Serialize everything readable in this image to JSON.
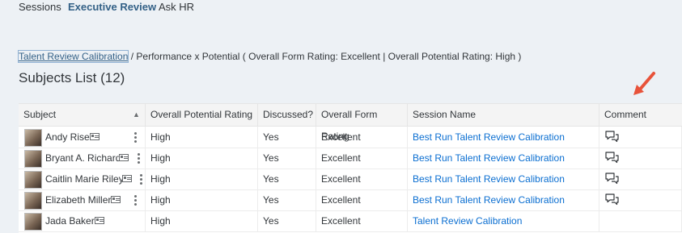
{
  "nav": {
    "tabs": [
      {
        "label": "Sessions"
      },
      {
        "label": "Executive Review",
        "active": true
      },
      {
        "label": "Ask HR"
      }
    ]
  },
  "breadcrumb": {
    "link": "Talent Review Calibration",
    "rest": " / Performance x Potential ( Overall Form Rating: Excellent | Overall Potential Rating: High )"
  },
  "list": {
    "title": "Subjects List (12)"
  },
  "table": {
    "columns": [
      "Subject",
      "Overall Potential Rating",
      "Discussed?",
      "Overall Form Rating",
      "Session Name",
      "Comment"
    ],
    "rows": [
      {
        "name": "Andy Rise",
        "potential": "High",
        "discussed": "Yes",
        "form": "Excellent",
        "session": "Best Run Talent Review Calibration",
        "comment_icon": "comment-icon"
      },
      {
        "name": "Bryant A. Richard",
        "potential": "High",
        "discussed": "Yes",
        "form": "Excellent",
        "session": "Best Run Talent Review Calibration",
        "comment_icon": "comment-icon"
      },
      {
        "name": "Caitlin Marie Riley",
        "potential": "High",
        "discussed": "Yes",
        "form": "Excellent",
        "session": "Best Run Talent Review Calibration",
        "comment_icon": "comment-icon"
      },
      {
        "name": "Elizabeth Miller",
        "potential": "High",
        "discussed": "Yes",
        "form": "Excellent",
        "session": "Best Run Talent Review Calibration",
        "comment_icon": "comment-icon"
      },
      {
        "name": "Jada Baker",
        "potential": "High",
        "discussed": "Yes",
        "form": "Excellent",
        "session": "Talent Review Calibration"
      }
    ]
  },
  "colors": {
    "accent": "#346187",
    "link": "#0a6ed1",
    "pointer_arrow": "#e8533a"
  }
}
